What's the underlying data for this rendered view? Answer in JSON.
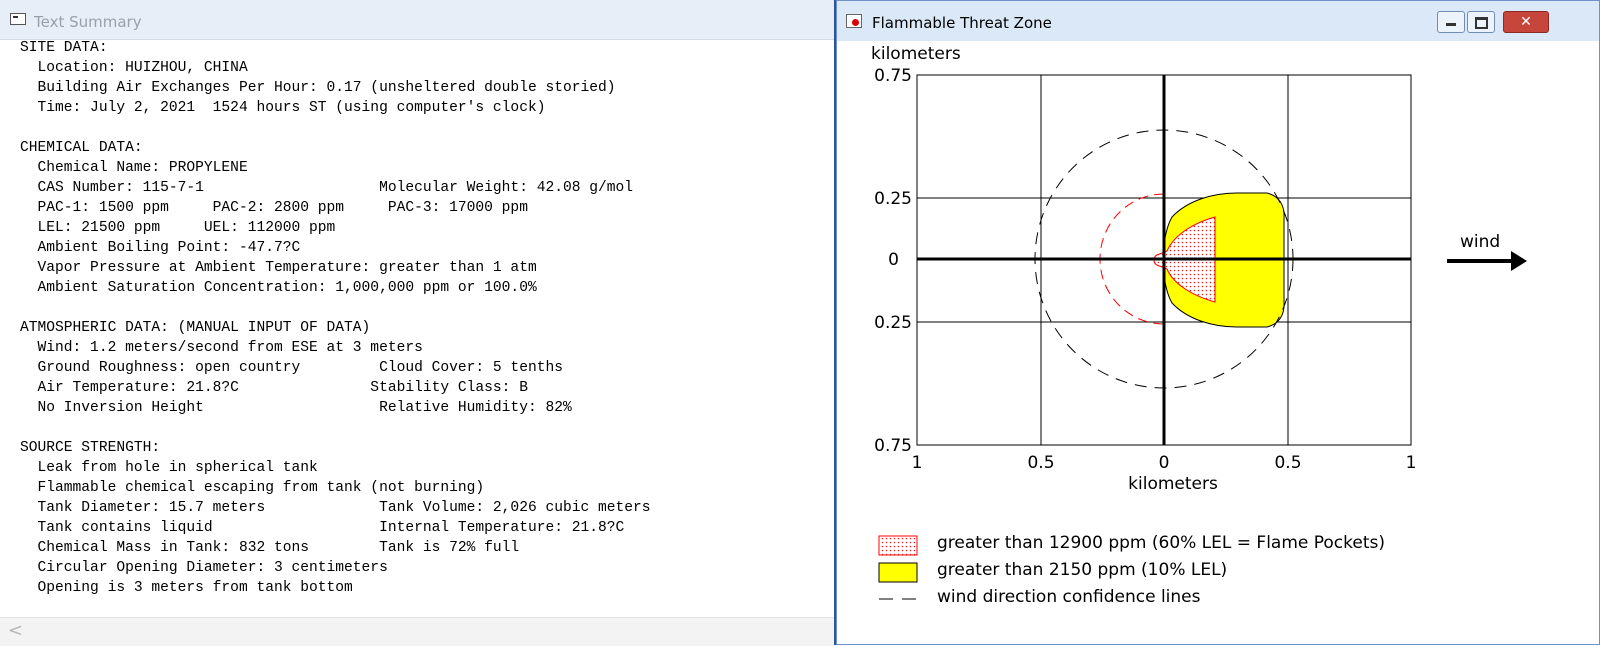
{
  "left_window": {
    "title": "Text Summary",
    "lines": [
      "SITE DATA:",
      "  Location: HUIZHOU, CHINA",
      "  Building Air Exchanges Per Hour: 0.17 (unsheltered double storied)",
      "  Time: July 2, 2021  1524 hours ST (using computer's clock)",
      "",
      "CHEMICAL DATA:",
      "  Chemical Name: PROPYLENE",
      "  CAS Number: 115-7-1                    Molecular Weight: 42.08 g/mol",
      "  PAC-1: 1500 ppm     PAC-2: 2800 ppm     PAC-3: 17000 ppm",
      "  LEL: 21500 ppm     UEL: 112000 ppm",
      "  Ambient Boiling Point: -47.7?C",
      "  Vapor Pressure at Ambient Temperature: greater than 1 atm",
      "  Ambient Saturation Concentration: 1,000,000 ppm or 100.0%",
      "",
      "ATMOSPHERIC DATA: (MANUAL INPUT OF DATA)",
      "  Wind: 1.2 meters/second from ESE at 3 meters",
      "  Ground Roughness: open country         Cloud Cover: 5 tenths",
      "  Air Temperature: 21.8?C               Stability Class: B",
      "  No Inversion Height                    Relative Humidity: 82%",
      "",
      "SOURCE STRENGTH:",
      "  Leak from hole in spherical tank",
      "  Flammable chemical escaping from tank (not burning)",
      "  Tank Diameter: 15.7 meters             Tank Volume: 2,026 cubic meters",
      "  Tank contains liquid                   Internal Temperature: 21.8?C",
      "  Chemical Mass in Tank: 832 tons        Tank is 72% full",
      "  Circular Opening Diameter: 3 centimeters",
      "  Opening is 3 meters from tank bottom"
    ],
    "scroll_left_glyph": "<"
  },
  "right_window": {
    "title": "Flammable Threat Zone",
    "buttons": {
      "close": "✕"
    },
    "plot": {
      "y_unit": "kilometers",
      "x_unit": "kilometers",
      "y_ticks": [
        "0.75",
        "0.25",
        "0",
        "0.25",
        "0.75"
      ],
      "x_ticks": [
        "1",
        "0.5",
        "0",
        "0.5",
        "1"
      ],
      "wind_label": "wind",
      "legend": [
        {
          "label": "greater than 12900 ppm (60% LEL = Flame Pockets)",
          "color": "#ff0000",
          "pattern": "red-dotted"
        },
        {
          "label": "greater than 2150 ppm (10% LEL)",
          "color": "#ffff00"
        },
        {
          "label": "wind direction confidence lines",
          "color": "#000000",
          "pattern": "dashed"
        }
      ],
      "colors": {
        "outer_zone": "#ffff00",
        "inner_zone": "#ff0000",
        "confidence": "#000000"
      }
    }
  }
}
